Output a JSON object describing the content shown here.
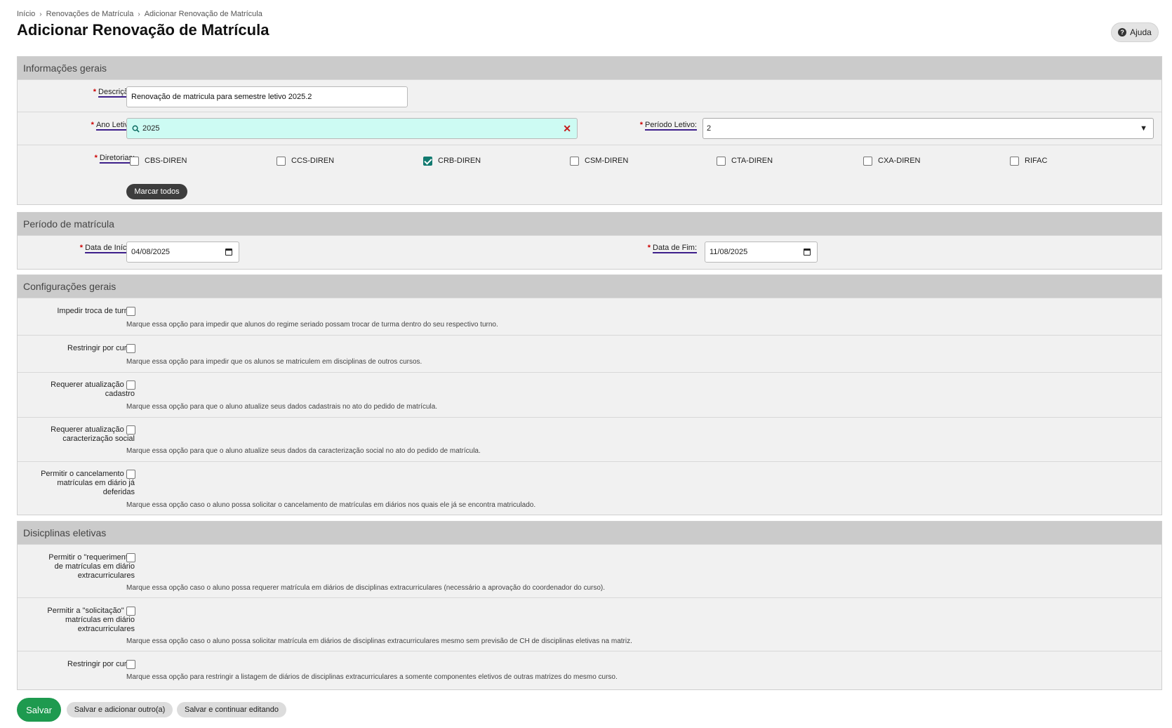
{
  "breadcrumb": {
    "items": [
      "Início",
      "Renovações de Matrícula",
      "Adicionar Renovação de Matrícula"
    ]
  },
  "page": {
    "title": "Adicionar Renovação de Matrícula",
    "help_label": "Ajuda"
  },
  "info_gerais": {
    "header": "Informações gerais",
    "descricao": {
      "label": "Descrição:",
      "value": "Renovação de matricula para semestre letivo 2025.2"
    },
    "ano_letivo": {
      "label": "Ano Letivo:",
      "value": "2025"
    },
    "periodo_letivo": {
      "label": "Período Letivo:",
      "value": "2"
    },
    "diretorias": {
      "label": "Diretorias:",
      "options": [
        {
          "label": "CBS-DIREN",
          "checked": false
        },
        {
          "label": "CCS-DIREN",
          "checked": false
        },
        {
          "label": "CRB-DIREN",
          "checked": true
        },
        {
          "label": "CSM-DIREN",
          "checked": false
        },
        {
          "label": "CTA-DIREN",
          "checked": false
        },
        {
          "label": "CXA-DIREN",
          "checked": false
        },
        {
          "label": "RIFAC",
          "checked": false
        }
      ],
      "mark_all": "Marcar todos"
    }
  },
  "periodo_matricula": {
    "header": "Período de matrícula",
    "data_inicio": {
      "label": "Data de Início:",
      "value": "04/08/2025"
    },
    "data_fim": {
      "label": "Data de Fim:",
      "value": "11/08/2025"
    }
  },
  "config_gerais": {
    "header": "Configurações gerais",
    "rows": [
      {
        "label": "Impedir troca de turma",
        "help": "Marque essa opção para impedir que alunos do regime seriado possam trocar de turma dentro do seu respectivo turno."
      },
      {
        "label": "Restringir por curso",
        "help": "Marque essa opção para impedir que os alunos se matriculem em disciplinas de outros cursos."
      },
      {
        "label": "Requerer atualização do cadastro",
        "help": "Marque essa opção para que o aluno atualize seus dados cadastrais no ato do pedido de matrícula."
      },
      {
        "label": "Requerer atualização da caracterização social",
        "help": "Marque essa opção para que o aluno atualize seus dados da caracterização social no ato do pedido de matrícula."
      },
      {
        "label": "Permitir o cancelamento de matrículas em diário já deferidas",
        "help": "Marque essa opção caso o aluno possa solicitar o cancelamento de matrículas em diários nos quais ele já se encontra matriculado."
      }
    ]
  },
  "eletivas": {
    "header": "Disicplinas eletivas",
    "rows": [
      {
        "label": "Permitir o \"requerimento\" de matrículas em diário extracurriculares",
        "help": "Marque essa opção caso o aluno possa requerer matrícula em diários de disciplinas extracurriculares (necessário a aprovação do coordenador do curso)."
      },
      {
        "label": "Permitir a \"solicitação\" de matrículas em diário extracurriculares",
        "help": "Marque essa opção caso o aluno possa solicitar matrícula em diários de disciplinas extracurriculares mesmo sem previsão de CH de disciplinas eletivas na matriz."
      },
      {
        "label": "Restringir por curso",
        "help": "Marque essa opção para restringir a listagem de diários de disciplinas extracurriculares a somente componentes eletivos de outras matrizes do mesmo curso."
      }
    ]
  },
  "actions": {
    "save": "Salvar",
    "save_add": "Salvar e adicionar outro(a)",
    "save_continue": "Salvar e continuar editando"
  }
}
